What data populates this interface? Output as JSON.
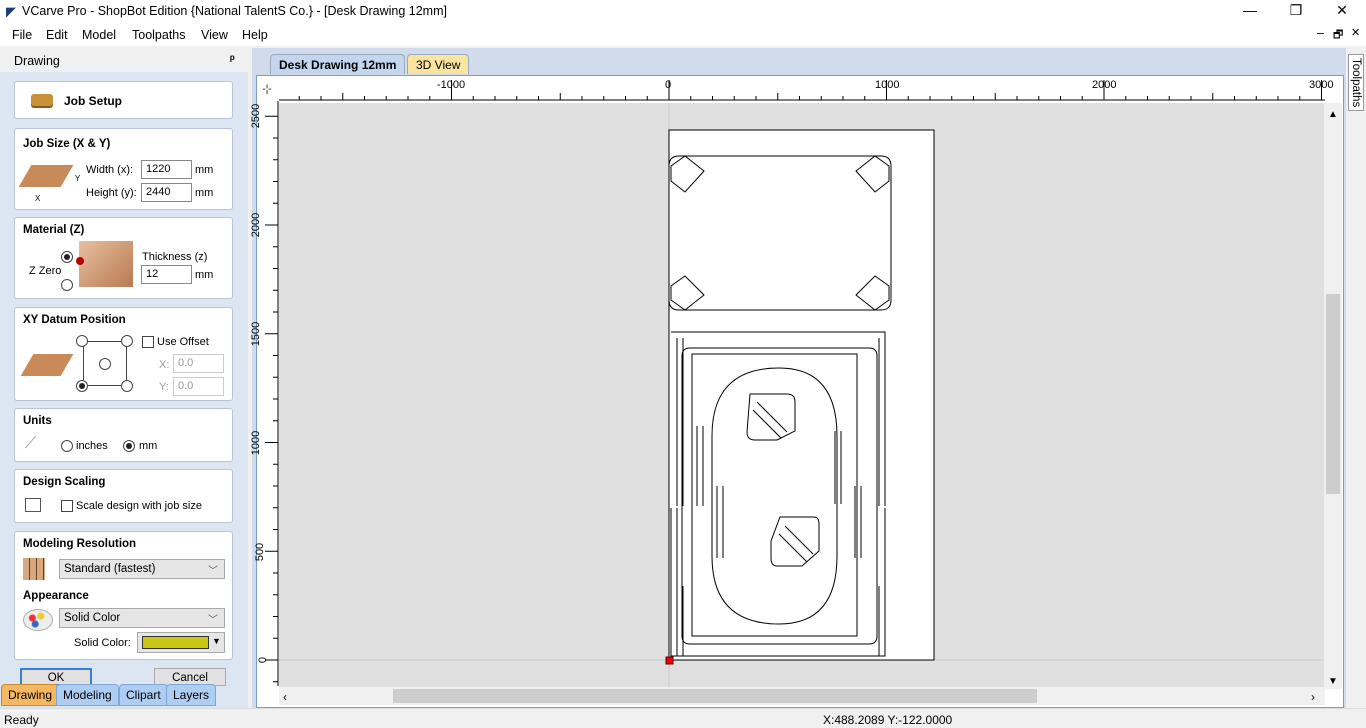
{
  "window": {
    "title": "VCarve Pro - ShopBot Edition {National TalentS Co.} - [Desk Drawing 12mm]",
    "minimize": "—",
    "restore": "❐",
    "close": "✕"
  },
  "menu": [
    "File",
    "Edit",
    "Model",
    "Toolpaths",
    "View",
    "Help"
  ],
  "mdi_controls": {
    "minimize": "–",
    "restore": "🗗",
    "close": "✕"
  },
  "panel": {
    "title": "Drawing",
    "pin": "ᵖ",
    "job_setup": "Job Setup",
    "job_size": {
      "title": "Job Size (X & Y)",
      "width_label": "Width (x):",
      "width": "1220",
      "height_label": "Height (y):",
      "height": "2440",
      "unit": "mm",
      "x": "X",
      "y": "Y"
    },
    "material": {
      "title": "Material (Z)",
      "z_zero": "Z Zero",
      "thickness_label": "Thickness (z)",
      "thickness": "12",
      "unit": "mm",
      "z_zero_top": true
    },
    "datum": {
      "title": "XY Datum Position",
      "use_offset": "Use Offset",
      "use_offset_checked": false,
      "x_label": "X:",
      "x": "0.0",
      "y_label": "Y:",
      "y": "0.0",
      "selected": "bottom-left"
    },
    "units": {
      "title": "Units",
      "inches": "inches",
      "mm": "mm",
      "selected": "mm"
    },
    "scaling": {
      "title": "Design Scaling",
      "scale_label": "Scale design with job size",
      "checked": false
    },
    "resolution": {
      "title": "Modeling Resolution",
      "value": "Standard (fastest)"
    },
    "appearance": {
      "title": "Appearance",
      "value": "Solid Color",
      "solid_color_label": "Solid Color:",
      "solid_color": "#c8c814"
    },
    "ok": "OK",
    "cancel": "Cancel"
  },
  "bottom_tabs": [
    "Drawing",
    "Modeling",
    "Clipart",
    "Layers"
  ],
  "view_tabs": [
    "Desk Drawing 12mm",
    "3D View"
  ],
  "ruler": {
    "x_ticks": [
      "-1000",
      "0",
      "1000",
      "2000",
      "3000"
    ],
    "y_ticks": [
      "2500",
      "2000",
      "1500",
      "1000",
      "500",
      "0"
    ]
  },
  "right_tab": "Toolpaths",
  "status": {
    "text": "Ready",
    "coords": "X:488.2089 Y:-122.0000"
  }
}
